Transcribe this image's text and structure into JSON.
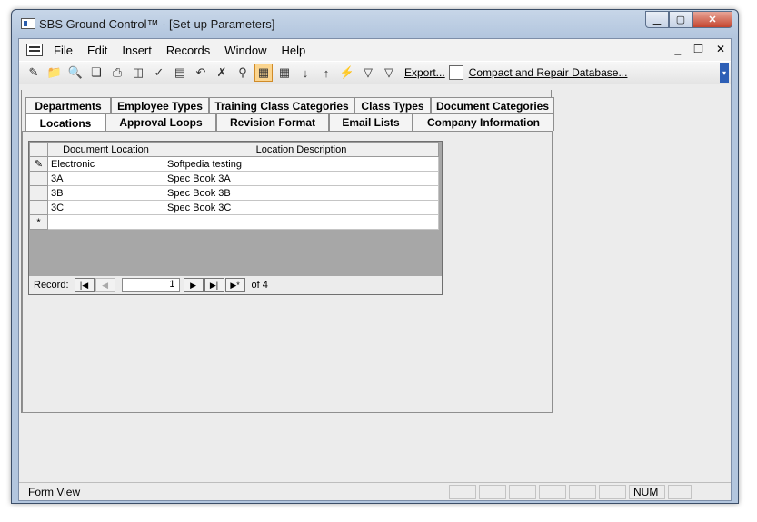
{
  "window": {
    "title": "SBS Ground Control™ - [Set-up Parameters]"
  },
  "menu": {
    "items": [
      "File",
      "Edit",
      "Insert",
      "Records",
      "Window",
      "Help"
    ]
  },
  "toolbar": {
    "export_label": "Export...",
    "compact_label": "Compact and Repair Database..."
  },
  "tabs": {
    "row1": [
      "Departments",
      "Employee Types",
      "Training Class Categories",
      "Class Types",
      "Document Categories"
    ],
    "row2": [
      "Locations",
      "Approval Loops",
      "Revision Format",
      "Email Lists",
      "Company Information"
    ],
    "selected": "Locations"
  },
  "grid": {
    "headers": [
      "Document Location",
      "Location Description"
    ],
    "rows": [
      {
        "location": "Electronic",
        "description": "Softpedia testing"
      },
      {
        "location": "3A",
        "description": "Spec Book 3A"
      },
      {
        "location": "3B",
        "description": "Spec Book 3B"
      },
      {
        "location": "3C",
        "description": "Spec Book 3C"
      }
    ],
    "new_row_marker": "*",
    "edit_marker": "✎"
  },
  "navigator": {
    "label": "Record:",
    "current": "1",
    "of_label": "of 4"
  },
  "status": {
    "view": "Form View",
    "num": "NUM"
  }
}
